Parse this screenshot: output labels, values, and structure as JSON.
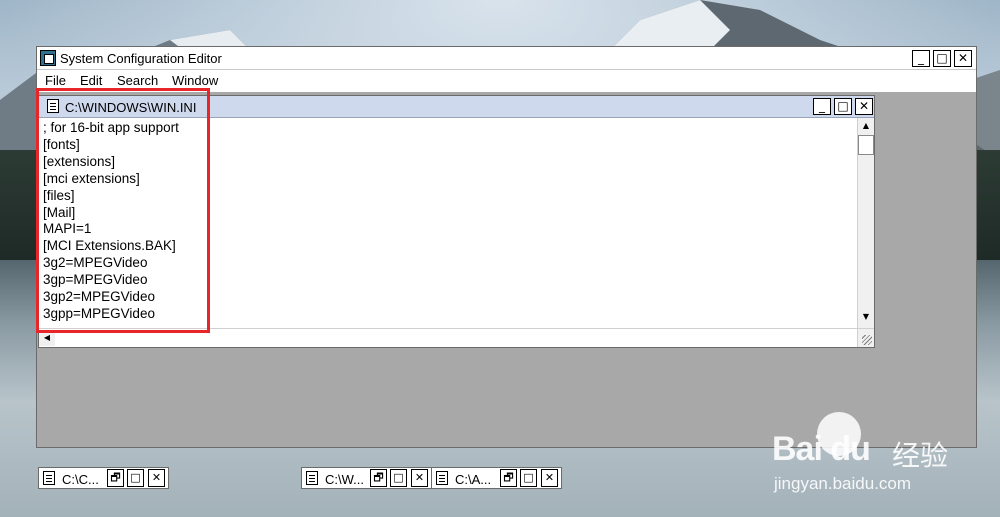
{
  "app": {
    "title": "System Configuration Editor",
    "icon": "sysedit-app-icon",
    "controls": {
      "minimize": "_",
      "maximize": "□",
      "close": "✕"
    }
  },
  "menu": {
    "items": [
      {
        "label": "File"
      },
      {
        "label": "Edit"
      },
      {
        "label": "Search"
      },
      {
        "label": "Window"
      }
    ]
  },
  "active_document": {
    "title": "C:\\WINDOWS\\WIN.INI",
    "icon": "document-icon",
    "controls": {
      "minimize": "_",
      "maximize": "□",
      "close": "✕"
    },
    "lines": [
      "; for 16-bit app support",
      "[fonts]",
      "[extensions]",
      "[mci extensions]",
      "[files]",
      "[Mail]",
      "MAPI=1",
      "[MCI Extensions.BAK]",
      "3g2=MPEGVideo",
      "3gp=MPEGVideo",
      "3gp2=MPEGVideo",
      "3gpp=MPEGVideo"
    ],
    "scrollbar": {
      "up_arrow": "▲",
      "down_arrow": "▼",
      "left_arrow": "◀"
    }
  },
  "minimized_documents": [
    {
      "title": "C:\\C...",
      "restore": "🗗",
      "maximize": "□",
      "close": "✕"
    },
    {
      "title": "C:\\W...",
      "restore": "🗗",
      "maximize": "□",
      "close": "✕"
    },
    {
      "title": "C:\\A...",
      "restore": "🗗",
      "maximize": "□",
      "close": "✕"
    }
  ],
  "annotation": {
    "highlight_color": "#e8262a"
  },
  "watermark": {
    "brand": "Bai du",
    "chinese": "经验",
    "url": "jingyan.baidu.com"
  },
  "colors": {
    "mdi_background": "#a8a8a8",
    "active_title_bar": "#cfd9ee",
    "window_background": "#ffffff"
  }
}
